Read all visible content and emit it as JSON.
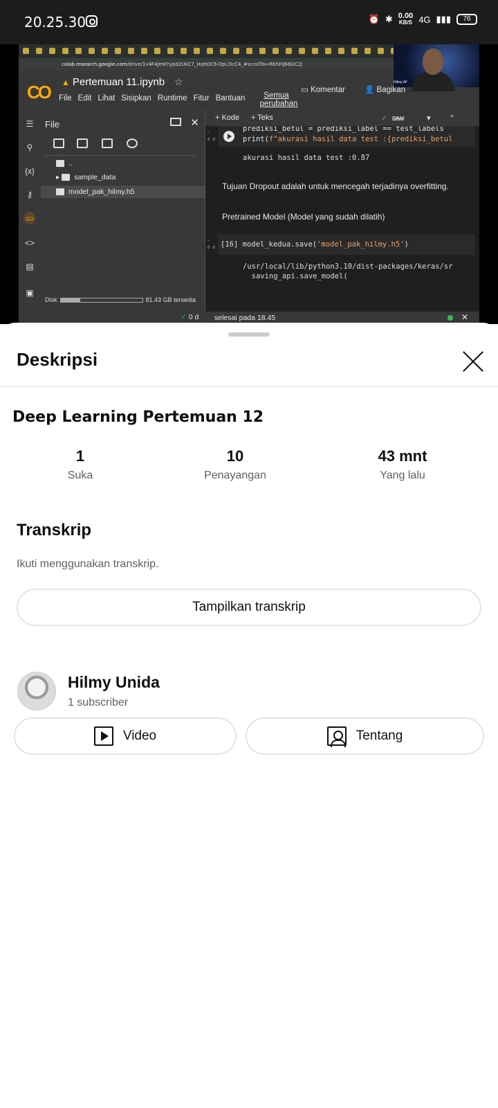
{
  "status_bar": {
    "time": "20.25.30",
    "speed_value": "0.00",
    "speed_unit": "KB/S",
    "network": "4G",
    "battery": "76"
  },
  "video": {
    "url": "colab.research.google.com",
    "url_path": "/drive/1v4F4JmKYypd2UkC7_HqhOC6-Dpi,DcC4_#scrollTo=Rb5FIJ66OC2j",
    "notebook_title": "Pertemuan 11.ipynb",
    "menu": [
      "File",
      "Edit",
      "Lihat",
      "Sisipkan",
      "Runtime",
      "Fitur",
      "Bantuan"
    ],
    "all_changes": "Semua perubahan",
    "comment": "Komentar",
    "share": "Bagikan",
    "webcam_label": "Hilmy AF",
    "file_panel_title": "File",
    "files": [
      "..",
      "sample_data",
      "model_pak_hilmy.h5"
    ],
    "disk_label": "Disk",
    "disk_fill_fraction": 0.24,
    "disk_free": "81.43 GB tersedia",
    "add_code": "+ Kode",
    "add_text": "+ Teks",
    "ram_label": "RAM",
    "disk_short": "Disk",
    "cell1_line1": "prediksi_betul = prediksi_label == test_labels",
    "cell1_line2_a": "print(",
    "cell1_line2_b": "f\"akurasi hasil data test :{prediksi_betul",
    "output1": "akurasi hasil data test :0.87",
    "markdown1": "Tujuan Dropout adalah untuk mencegah terjadinya overfitting.",
    "markdown2": "Pretrained Model (Model yang sudah dilatih)",
    "cell2_num": "[16]",
    "cell2_code_a": "model_kedua.save(",
    "cell2_code_b": "'model_pak_hilmy.h5'",
    "cell2_code_c": ")",
    "output2": "/usr/local/lib/python3.10/dist-packages/keras/sr\n  saving_api.save_model(",
    "gutter_mark": "0 d",
    "status_time": "0 d",
    "status_text": "selesai pada 18.45",
    "playback_progress": 0.03
  },
  "sheet": {
    "title": "Deskripsi",
    "video_title": "Deep Learning Pertemuan 12",
    "stats": [
      {
        "value": "1",
        "label": "Suka"
      },
      {
        "value": "10",
        "label": "Penayangan"
      },
      {
        "value": "43 mnt",
        "label": "Yang lalu"
      }
    ],
    "transcript_title": "Transkrip",
    "transcript_sub": "Ikuti menggunakan transkrip.",
    "transcript_button": "Tampilkan transkrip",
    "channel_name": "Hilmy Unida",
    "subscribers": "1 subscriber",
    "video_button": "Video",
    "about_button": "Tentang"
  }
}
